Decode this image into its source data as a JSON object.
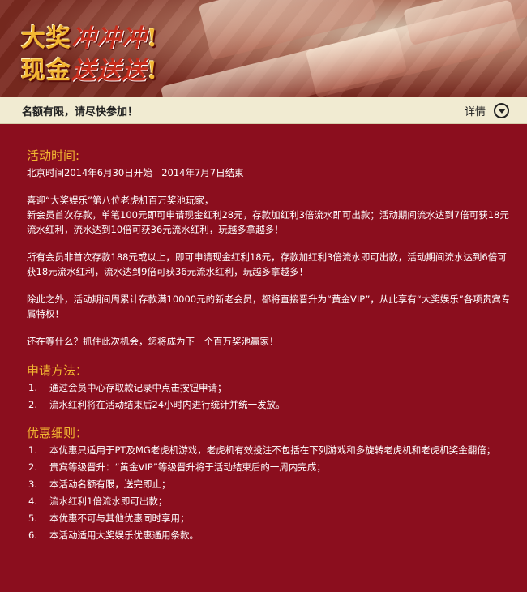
{
  "banner": {
    "line1_main": "大奖",
    "line1_swash": "冲冲冲",
    "line1_mark": "!",
    "line2_main": "现金",
    "line2_swash": "送送送",
    "line2_mark": "!"
  },
  "notice": {
    "text": "名额有限，请尽快参加！",
    "details_label": "详情"
  },
  "activity_time": {
    "title": "活动时间:",
    "text": "北京时间2014年6月30日开始　2014年7月7日结束"
  },
  "paragraphs": [
    "喜迎“大奖娱乐”第八位老虎机百万奖池玩家，",
    "新会员首次存款，单笔100元即可申请现金红利28元，存款加红利3倍流水即可出款；活动期间流水达到7倍可获18元流水红利，流水达到10倍可获36元流水红利，玩越多拿越多！",
    "所有会员非首次存款188元或以上，即可申请现金红利18元，存款加红利3倍流水即可出款，活动期间流水达到6倍可获18元流水红利，流水达到9倍可获36元流水红利，玩越多拿越多！",
    "除此之外，活动期间周累计存款满10000元的新老会员，都将直接晋升为“黄金VIP”，从此享有“大奖娱乐”各项贵宾专属特权！",
    "还在等什么？抓住此次机会，您将成为下一个百万奖池赢家！"
  ],
  "apply": {
    "title": "申请方法：",
    "items": [
      {
        "num": "1.",
        "text": "通过会员中心存取款记录中点击按钮申请；"
      },
      {
        "num": "2.",
        "text": "流水红利将在活动结束后24小时内进行统计并统一发放。"
      }
    ]
  },
  "terms": {
    "title": "优惠细则：",
    "items": [
      {
        "num": "1.",
        "text": "本优惠只适用于PT及MG老虎机游戏，老虎机有效投注不包括在下列游戏和多旋转老虎机和老虎机奖金翻倍；"
      },
      {
        "num": "2.",
        "text": "贵宾等级晋升：“黄金VIP”等级晋升将于活动结束后的一周内完成；"
      },
      {
        "num": "3.",
        "text": "本活动名额有限，送完即止；"
      },
      {
        "num": "4.",
        "text": "流水红利1倍流水即可出款；"
      },
      {
        "num": "5.",
        "text": "本优惠不可与其他优惠同时享用；"
      },
      {
        "num": "6.",
        "text": "本活动适用大奖娱乐优惠通用条款。"
      }
    ]
  },
  "colors": {
    "background": "#8b0e1e",
    "heading_gold": "#f2b632",
    "notice_bar": "#f1ebd2"
  }
}
